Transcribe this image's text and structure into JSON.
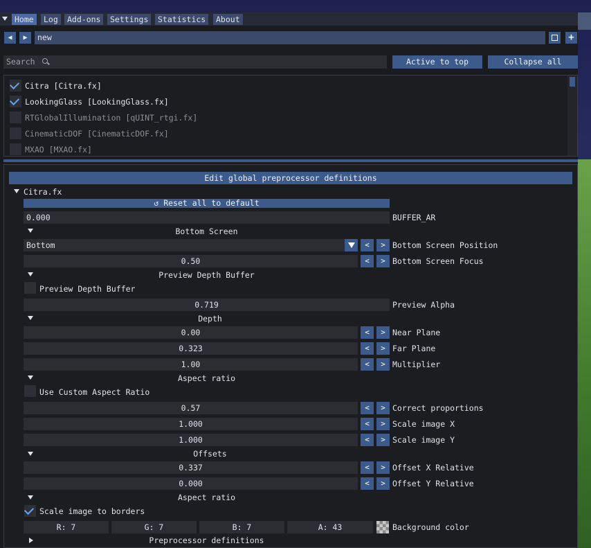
{
  "menu": {
    "items": [
      "Home",
      "Log",
      "Add-ons",
      "Settings",
      "Statistics",
      "About"
    ]
  },
  "preset": {
    "name": "new",
    "prev": "◀",
    "next": "▶",
    "save": "save",
    "add": "+"
  },
  "search": {
    "placeholder": "Search",
    "active_to_top": "Active to top",
    "collapse_all": "Collapse all"
  },
  "effects": [
    {
      "label": "Citra [Citra.fx]",
      "checked": true
    },
    {
      "label": "LookingGlass [LookingGlass.fx]",
      "checked": true
    },
    {
      "label": "RTGlobalIllumination [qUINT_rtgi.fx]",
      "checked": false
    },
    {
      "label": "CinematicDOF [CinematicDOF.fx]",
      "checked": false
    },
    {
      "label": "MXAO [MXAO.fx]",
      "checked": false
    }
  ],
  "panel": {
    "edit_global": "Edit global preprocessor definitions",
    "file": "Citra.fx",
    "reset_all": "Reset all to default",
    "buffer_ar_value": "0.000",
    "buffer_ar_label": "BUFFER_AR",
    "sec_bottom": "Bottom Screen",
    "bottom_pos_value": "Bottom",
    "bottom_pos_label": "Bottom Screen Position",
    "bottom_focus_value": "0.50",
    "bottom_focus_label": "Bottom Screen Focus",
    "sec_preview": "Preview Depth Buffer",
    "preview_check_label": "Preview Depth Buffer",
    "preview_alpha_value": "0.719",
    "preview_alpha_label": "Preview Alpha",
    "sec_depth": "Depth",
    "near_value": "0.00",
    "near_label": "Near Plane",
    "far_value": "0.323",
    "far_label": "Far Plane",
    "mult_value": "1.00",
    "mult_label": "Multiplier",
    "sec_aspect": "Aspect ratio",
    "custom_aspect_label": "Use Custom Aspect Ratio",
    "correct_value": "0.57",
    "correct_label": "Correct proportions",
    "scalex_value": "1.000",
    "scalex_label": "Scale image X",
    "scaley_value": "1.000",
    "scaley_label": "Scale image Y",
    "sec_offsets": "Offsets",
    "offx_value": "0.337",
    "offx_label": "Offset X Relative",
    "offy_value": "0.000",
    "offy_label": "Offset Y Relative",
    "sec_aspect2": "Aspect ratio",
    "scale_borders_label": "Scale image to borders",
    "bg_r": "R:  7",
    "bg_g": "G:  7",
    "bg_b": "B:  7",
    "bg_a": "A: 43",
    "bg_label": "Background color",
    "sec_preproc": "Preprocessor definitions",
    "less": "<",
    "more": ">"
  },
  "colors": {
    "accent": "#3c5a8c",
    "menu_active": "#4c6ba6",
    "window": "#1a1b1f",
    "field": "#2b2d33"
  }
}
